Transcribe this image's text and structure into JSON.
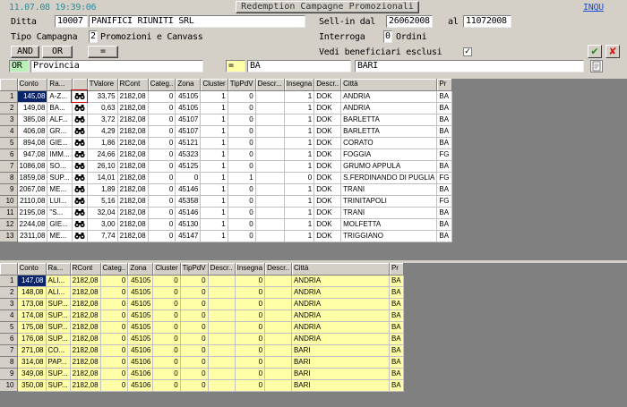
{
  "header": {
    "timestamp": "11.07.08 19:39:06",
    "title": "Redemption Campagne Promozionali",
    "mode": "INQU"
  },
  "filters": {
    "ditta_label": "Ditta",
    "ditta_code": "10007",
    "ditta_name": "PANIFICI RIUNITI SRL",
    "sellin_label": "Sell-in dal",
    "sellin_from": "26062008",
    "al_label": "al",
    "sellin_to": "11072008",
    "tipo_label": "Tipo Campagna",
    "tipo_code": "2",
    "tipo_desc": "Promozioni e Canvass",
    "interroga_label": "Interroga",
    "interroga_code": "0",
    "interroga_desc": "Ordini",
    "vedi_label": "Vedi beneficiari esclusi",
    "vedi_checked": "✓"
  },
  "logic": {
    "and_label": "AND",
    "or_label": "OR",
    "eq_label": "=",
    "op_current": "OR",
    "field": "Provincia",
    "cmp": "=",
    "value": "BA",
    "value_desc": "BARI"
  },
  "actions": {
    "confirm_icon": "✔",
    "cancel_icon": "✘"
  },
  "colors": {
    "teal": "#2b8c9c",
    "selection": "#0a246a",
    "yellow": "#ffffa8"
  },
  "grid1": {
    "columns": [
      "Conto",
      "Ra...",
      "",
      "TValore",
      "RCont",
      "Categ..",
      "Zona",
      "Cluster",
      "TipPdV",
      "Descr...",
      "Insegna",
      "Descr..",
      "Città",
      "Pr"
    ],
    "rows": [
      [
        "1",
        "145,08",
        "A-Z...",
        "",
        "33,75",
        "2182,08",
        "0",
        "45105",
        "1",
        "0",
        "",
        "1",
        "DOK",
        "ANDRIA",
        "BA"
      ],
      [
        "2",
        "149,08",
        "BA...",
        "",
        "0,63",
        "2182,08",
        "0",
        "45105",
        "1",
        "0",
        "",
        "1",
        "DOK",
        "ANDRIA",
        "BA"
      ],
      [
        "3",
        "385,08",
        "ALF...",
        "",
        "3,72",
        "2182,08",
        "0",
        "45107",
        "1",
        "0",
        "",
        "1",
        "DOK",
        "BARLETTA",
        "BA"
      ],
      [
        "4",
        "406,08",
        "GR...",
        "",
        "4,29",
        "2182,08",
        "0",
        "45107",
        "1",
        "0",
        "",
        "1",
        "DOK",
        "BARLETTA",
        "BA"
      ],
      [
        "5",
        "894,08",
        "GIE...",
        "",
        "1,86",
        "2182,08",
        "0",
        "45121",
        "1",
        "0",
        "",
        "1",
        "DOK",
        "CORATO",
        "BA"
      ],
      [
        "6",
        "947,08",
        "IMM...",
        "",
        "24,66",
        "2182,08",
        "0",
        "45323",
        "1",
        "0",
        "",
        "1",
        "DOK",
        "FOGGIA",
        "FG"
      ],
      [
        "7",
        "1086,08",
        "SO...",
        "",
        "26,10",
        "2182,08",
        "0",
        "45125",
        "1",
        "0",
        "",
        "1",
        "DOK",
        "GRUMO APPULA",
        "BA"
      ],
      [
        "8",
        "1859,08",
        "SUP...",
        "",
        "14,01",
        "2182,08",
        "0",
        "0",
        "1",
        "1",
        "",
        "0",
        "DOK",
        "S.FERDINANDO DI PUGLIA",
        "FG"
      ],
      [
        "9",
        "2067,08",
        "ME...",
        "",
        "1,89",
        "2182,08",
        "0",
        "45146",
        "1",
        "0",
        "",
        "1",
        "DOK",
        "TRANI",
        "BA"
      ],
      [
        "10",
        "2110,08",
        "LUI...",
        "",
        "5,16",
        "2182,08",
        "0",
        "45358",
        "1",
        "0",
        "",
        "1",
        "DOK",
        "TRINITAPOLI",
        "FG"
      ],
      [
        "11",
        "2195,08",
        "\"S...",
        "",
        "32,04",
        "2182,08",
        "0",
        "45146",
        "1",
        "0",
        "",
        "1",
        "DOK",
        "TRANI",
        "BA"
      ],
      [
        "12",
        "2244,08",
        "GIE...",
        "",
        "3,00",
        "2182,08",
        "0",
        "45130",
        "1",
        "0",
        "",
        "1",
        "DOK",
        "MOLFETTA",
        "BA"
      ],
      [
        "13",
        "2311,08",
        "ME...",
        "",
        "7,74",
        "2182,08",
        "0",
        "45147",
        "1",
        "0",
        "",
        "1",
        "DOK",
        "TRIGGIANO",
        "BA"
      ]
    ]
  },
  "grid2": {
    "columns": [
      "Conto",
      "Ra...",
      "RCont",
      "Categ..",
      "Zona",
      "Cluster",
      "TipPdV",
      "Descr..",
      "Insegna",
      "Descr..",
      "Città",
      "Pr"
    ],
    "rows": [
      [
        "1",
        "147,08",
        "ALI...",
        "2182,08",
        "0",
        "45105",
        "0",
        "0",
        "",
        "0",
        "",
        "ANDRIA",
        "BA"
      ],
      [
        "2",
        "148,08",
        "ALI...",
        "2182,08",
        "0",
        "45105",
        "0",
        "0",
        "",
        "0",
        "",
        "ANDRIA",
        "BA"
      ],
      [
        "3",
        "173,08",
        "SUP...",
        "2182,08",
        "0",
        "45105",
        "0",
        "0",
        "",
        "0",
        "",
        "ANDRIA",
        "BA"
      ],
      [
        "4",
        "174,08",
        "SUP...",
        "2182,08",
        "0",
        "45105",
        "0",
        "0",
        "",
        "0",
        "",
        "ANDRIA",
        "BA"
      ],
      [
        "5",
        "175,08",
        "SUP...",
        "2182,08",
        "0",
        "45105",
        "0",
        "0",
        "",
        "0",
        "",
        "ANDRIA",
        "BA"
      ],
      [
        "6",
        "176,08",
        "SUP...",
        "2182,08",
        "0",
        "45105",
        "0",
        "0",
        "",
        "0",
        "",
        "ANDRIA",
        "BA"
      ],
      [
        "7",
        "271,08",
        "CO...",
        "2182,08",
        "0",
        "45106",
        "0",
        "0",
        "",
        "0",
        "",
        "BARI",
        "BA"
      ],
      [
        "8",
        "314,08",
        "PAP...",
        "2182,08",
        "0",
        "45106",
        "0",
        "0",
        "",
        "0",
        "",
        "BARI",
        "BA"
      ],
      [
        "9",
        "349,08",
        "SUP...",
        "2182,08",
        "0",
        "45106",
        "0",
        "0",
        "",
        "0",
        "",
        "BARI",
        "BA"
      ],
      [
        "10",
        "350,08",
        "SUP...",
        "2182,08",
        "0",
        "45106",
        "0",
        "0",
        "",
        "0",
        "",
        "BARI",
        "BA"
      ]
    ]
  }
}
